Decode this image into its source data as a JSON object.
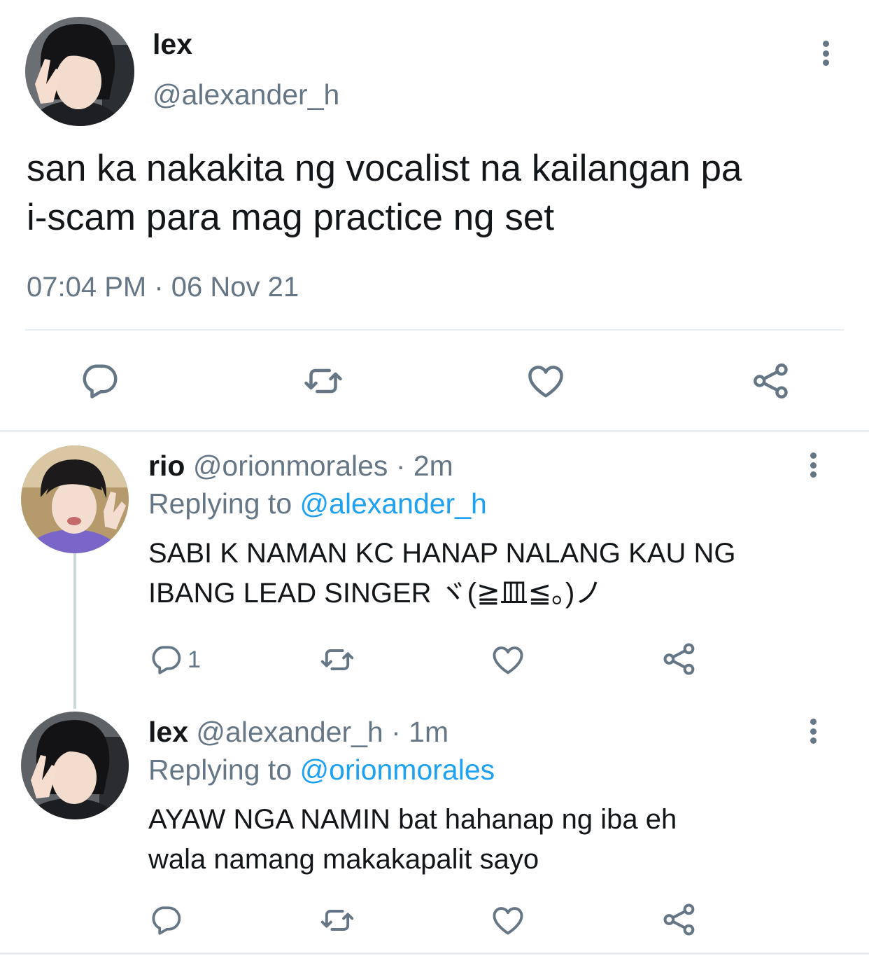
{
  "main_tweet": {
    "name": "lex",
    "handle": "@alexander_h",
    "text_line1": "san ka nakakita ng vocalist na kailangan pa",
    "text_line2": "i-scam para mag practice ng set",
    "timestamp": "07:04 PM · 06 Nov 21"
  },
  "replies": [
    {
      "name": "rio",
      "meta": "@orionmorales · 2m",
      "replying_prefix": "Replying to ",
      "replying_to": "@alexander_h",
      "text_line1": "SABI K NAMAN KC HANAP NALANG KAU NG",
      "text_line2": "IBANG LEAD SINGER ヾ(≧皿≦。)ノ",
      "reply_count": "1"
    },
    {
      "name": "lex",
      "meta": "@alexander_h · 1m",
      "replying_prefix": "Replying to ",
      "replying_to": "@orionmorales",
      "text_line1": "AYAW NGA NAMIN bat hahanap ng iba eh",
      "text_line2": "wala namang makakapalit sayo",
      "reply_count": ""
    }
  ],
  "icons": [
    "reply-icon",
    "retweet-icon",
    "like-icon",
    "share-icon",
    "more-icon"
  ],
  "colors": {
    "accent": "#1da1f2",
    "secondary_text": "#657786",
    "icon_gray": "#657786"
  }
}
